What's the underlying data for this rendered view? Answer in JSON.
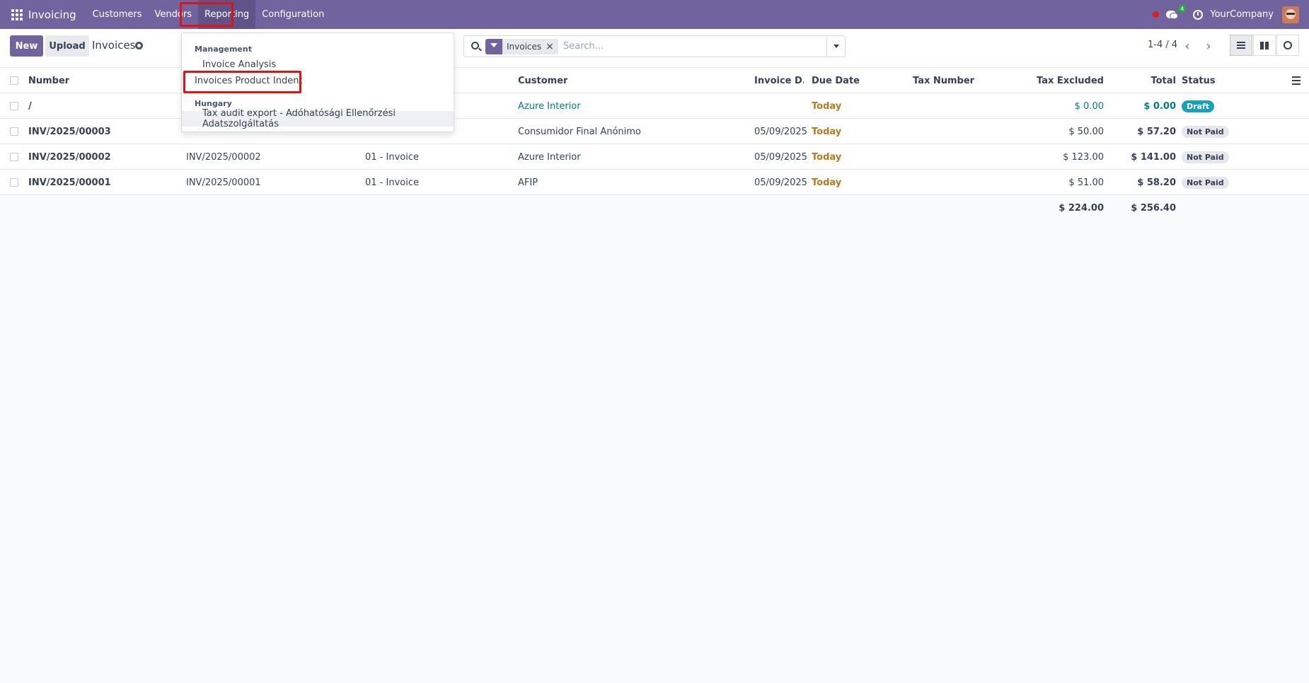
{
  "navbar": {
    "brand": "Invoicing",
    "menu": [
      "Customers",
      "Vendors",
      "Reporting",
      "Configuration"
    ],
    "chat_count": "4",
    "company": "YourCompany"
  },
  "control": {
    "new_label": "New",
    "upload_label": "Upload",
    "breadcrumb": "Invoices",
    "facet": "Invoices",
    "search_placeholder": "Search...",
    "pager": "1-4 / 4"
  },
  "dropdown": {
    "section_management": "Management",
    "invoice_analysis": "Invoice Analysis",
    "invoices_product_indent": "Invoices Product Indent",
    "section_hungary": "Hungary",
    "tax_audit_export": "Tax audit export - Adóhatósági Ellenőrzési Adatszolgáltatás"
  },
  "table": {
    "headers": {
      "number": "Number",
      "customer": "Customer",
      "invoice_date": "Invoice D...",
      "due_date": "Due Date",
      "tax_number": "Tax Number",
      "tax_excluded": "Tax Excluded",
      "total": "Total",
      "status": "Status"
    },
    "rows": [
      {
        "number": "/",
        "ref": "",
        "journal": "",
        "customer": "Azure Interior",
        "invoice_date": "",
        "due_date": "Today",
        "tax_number": "",
        "tax_excluded": "$ 0.00",
        "total": "$ 0.00",
        "status": "Draft"
      },
      {
        "number": "INV/2025/00003",
        "ref": "",
        "journal": "",
        "customer": "Consumidor Final Anónimo",
        "invoice_date": "05/09/2025",
        "due_date": "Today",
        "tax_number": "",
        "tax_excluded": "$ 50.00",
        "total": "$ 57.20",
        "status": "Not Paid"
      },
      {
        "number": "INV/2025/00002",
        "ref": "INV/2025/00002",
        "journal": "01 - Invoice",
        "customer": "Azure Interior",
        "invoice_date": "05/09/2025",
        "due_date": "Today",
        "tax_number": "",
        "tax_excluded": "$ 123.00",
        "total": "$ 141.00",
        "status": "Not Paid"
      },
      {
        "number": "INV/2025/00001",
        "ref": "INV/2025/00001",
        "journal": "01 - Invoice",
        "customer": "AFIP",
        "invoice_date": "05/09/2025",
        "due_date": "Today",
        "tax_number": "",
        "tax_excluded": "$ 51.00",
        "total": "$ 58.20",
        "status": "Not Paid"
      }
    ],
    "totals": {
      "tax_excluded": "$ 224.00",
      "total": "$ 256.40"
    }
  },
  "colors": {
    "brand": "#71639e",
    "highlight_box": "#e11212",
    "link": "#017e84",
    "today": "#b7791f",
    "draft_badge": "#17a2b8"
  }
}
